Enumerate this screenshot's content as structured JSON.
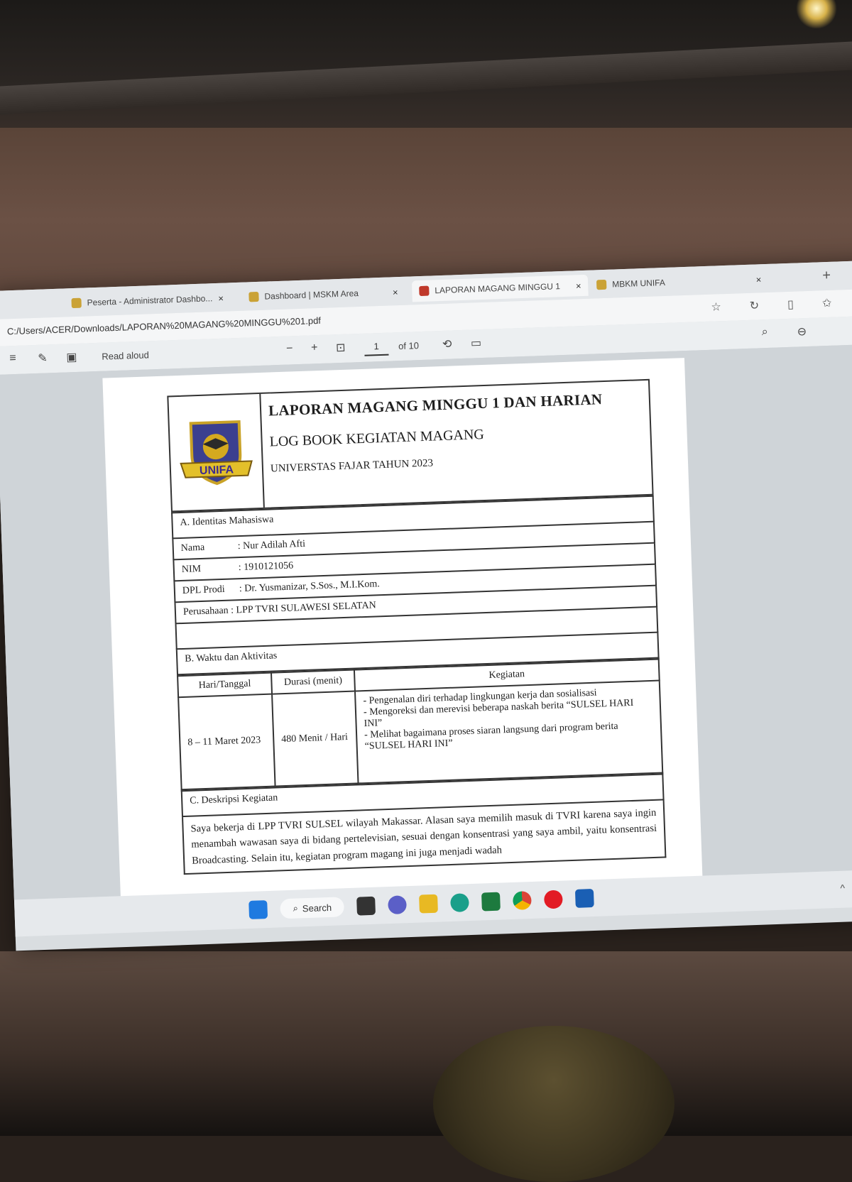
{
  "browser": {
    "tabs": [
      {
        "label": "Peserta - Administrator Dashbo...",
        "close": "×"
      },
      {
        "label": "Dashboard | MSKM Area",
        "close": "×"
      },
      {
        "label": "LAPORAN MAGANG MINGGU 1",
        "close": "×"
      },
      {
        "label": "MBKM UNIFA",
        "close": "×"
      }
    ],
    "new_tab": "+",
    "address": "C:/Users/ACER/Downloads/LAPORAN%20MAGANG%20MINGGU%201.pdf"
  },
  "pdf_toolbar": {
    "read_aloud": "Read aloud",
    "zoom_out": "−",
    "zoom_in": "+",
    "page_current": "1",
    "page_total": "of 10"
  },
  "document": {
    "logo_text": "UNIFA",
    "title_1": "LAPORAN MAGANG MINGGU 1 DAN HARIAN",
    "title_2": "LOG BOOK KEGIATAN MAGANG",
    "title_3": "UNIVERSTAS FAJAR TAHUN 2023",
    "section_a": "A. Identitas Mahasiswa",
    "nama_label": "Nama",
    "nama_value": ": Nur Adilah Afti",
    "nim_label": "NIM",
    "nim_value": ": 1910121056",
    "dpl_label": "DPL Prodi",
    "dpl_value": ": Dr. Yusmanizar, S.Sos., M.I.Kom.",
    "perusahaan": "Perusahaan : LPP TVRI SULAWESI SELATAN",
    "section_b": "B. Waktu dan Aktivitas",
    "col_hari": "Hari/Tanggal",
    "col_durasi": "Durasi (menit)",
    "col_kegiatan": "Kegiatan",
    "row_hari": "8 – 11 Maret 2023",
    "row_durasi": "480 Menit / Hari",
    "row_kegiatan_1": "- Pengenalan diri terhadap lingkungan kerja dan sosialisasi",
    "row_kegiatan_2": "- Mengoreksi dan merevisi beberapa naskah berita “SULSEL HARI INI”",
    "row_kegiatan_3": "- Melihat bagaimana proses siaran langsung dari program berita “SULSEL HARI INI”",
    "section_c": "C. Deskripsi Kegiatan",
    "desc": "Saya bekerja di LPP TVRI SULSEL wilayah Makassar. Alasan saya memilih masuk di TVRI karena saya ingin menambah wawasan saya di bidang pertelevisian, sesuai dengan konsentrasi yang saya ambil, yaitu konsentrasi Broadcasting. Selain itu, kegiatan program magang ini juga menjadi wadah"
  },
  "taskbar": {
    "search_label": "Search"
  }
}
